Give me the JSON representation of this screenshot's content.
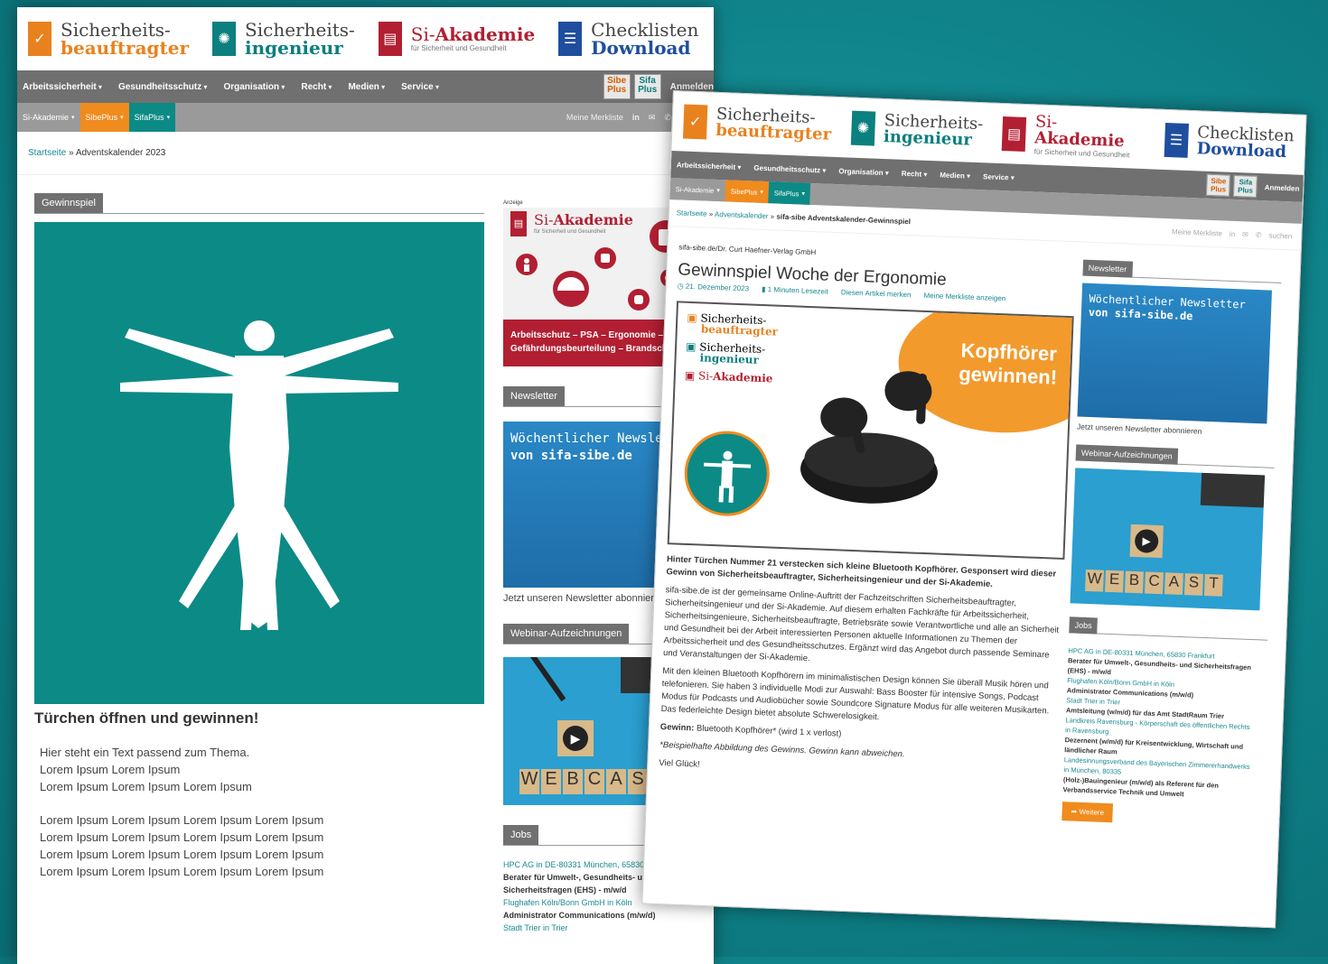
{
  "brands": [
    {
      "line1": "Sicherheits-",
      "line2": "beauftragter",
      "sub": "",
      "color": "#e8821e"
    },
    {
      "line1": "Sicherheits-",
      "line2": "ingenieur",
      "sub": "",
      "color": "#0c7f7f"
    },
    {
      "line1": "Si-",
      "line2": "Akademie",
      "sub": "für Sicherheit und Gesundheit",
      "color": "#b21f32"
    },
    {
      "line1": "Checklisten",
      "line2": "Download",
      "sub": "",
      "color": "#1f4e9e"
    }
  ],
  "nav": {
    "items": [
      "Arbeitssicherheit",
      "Gesundheitsschutz",
      "Organisation",
      "Recht",
      "Medien",
      "Service"
    ],
    "sibe_plus_top": "Sibe",
    "sibe_plus_bottom": "Plus",
    "sifa_plus_top": "Sifa",
    "sifa_plus_bottom": "Plus",
    "login": "Anmelden"
  },
  "subnav": {
    "tabs": [
      "Si-Akademie",
      "SibePlus",
      "SifaPlus"
    ],
    "merkliste": "Meine Merkliste",
    "linkedin": "in",
    "search_placeholder": "suchen"
  },
  "colors": {
    "teal": "#0c8a86",
    "orange": "#f08b1e",
    "red": "#b21f32",
    "gray": "#707070"
  },
  "page1": {
    "breadcrumb_home": "Startseite",
    "breadcrumb_sep": " » ",
    "breadcrumb_current": "Adventskalender 2023",
    "section": "Gewinnspiel",
    "heading": "Türchen öffnen und gewinnen!",
    "para1_lines": [
      "Hier steht ein Text passend zum Thema.",
      "Lorem Ipsum Lorem Ipsum",
      "Lorem Ipsum Lorem Ipsum Lorem Ipsum"
    ],
    "para2_lines": [
      "Lorem Ipsum Lorem Ipsum Lorem Ipsum Lorem Ipsum",
      "Lorem Ipsum Lorem Ipsum Lorem Ipsum Lorem Ipsum",
      "Lorem Ipsum Lorem Ipsum Lorem Ipsum Lorem Ipsum",
      "Lorem Ipsum Lorem Ipsum Lorem Ipsum Lorem Ipsum"
    ]
  },
  "sidebar": {
    "ad_label": "Anzeige",
    "ad_brand_line1": "Si-",
    "ad_brand_line2": "Akademie",
    "ad_brand_sub": "für Sicherheit und Gesundheit",
    "ad_text_line1": "Arbeitsschutz – PSA – Ergonomie –",
    "ad_text_line2": "Gefährdungsbeurteilung – Brandschutz",
    "newsletter_title": "Newsletter",
    "newsletter_line1": "Wöchentlicher Newsletter",
    "newsletter_line2": "von sifa-sibe.de",
    "newsletter_caption": "Jetzt unseren Newsletter abonnieren",
    "webinar_title": "Webinar-Aufzeichnungen",
    "webcast_letters": [
      "W",
      "E",
      "B",
      "C",
      "A",
      "S",
      "T"
    ],
    "jobs_title": "Jobs",
    "jobs": [
      {
        "company": "HPC AG in DE-80331 München, 65830 Frankfurt",
        "title_lines": [
          "Berater für Umwelt-, Gesundheits- und",
          "Sicherheitsfragen (EHS) - m/w/d"
        ]
      },
      {
        "company": "Flughafen Köln/Bonn GmbH in Köln",
        "title_lines": [
          "Administrator Communications (m/w/d)"
        ]
      },
      {
        "company": "Stadt Trier in Trier",
        "title_lines": []
      }
    ]
  },
  "page2": {
    "breadcrumb_home": "Startseite",
    "breadcrumb_mid": "Adventskalender",
    "breadcrumb_current": "sifa-sibe Adventskalender-Gewinnspiel",
    "publisher": "sifa-sibe.de/Dr. Curt Haefner-Verlag GmbH",
    "title": "Gewinnspiel Woche der Ergonomie",
    "date": "21. Dezember 2023",
    "readtime": "1 Minuten Lesezeit",
    "bookmark": "Diesen Artikel merken",
    "show_list": "Meine Merkliste anzeigen",
    "promo_line1": "Kopfhörer",
    "promo_line2": "gewinnen!",
    "lead": "Hinter Türchen Nummer 21 verstecken sich kleine Bluetooth Kopfhörer. Gesponsert wird dieser Gewinn von Sicherheitsbeauftragter, Sicherheitsingenieur und der Si-Akademie.",
    "body1": "sifa-sibe.de ist der gemeinsame Online-Auftritt der Fachzeitschriften Sicherheitsbeauftragter, Sicherheitsingenieur und der Si-Akademie. Auf diesem erhalten Fachkräfte für Arbeitssicherheit, Sicherheitsingenieure, Sicherheitsbeauftragte, Betriebsräte sowie Verantwortliche und alle an Sicherheit und Gesundheit bei der Arbeit interessierten Personen aktuelle Informationen zu Themen der Arbeitssicherheit und des Gesundheitsschutzes. Ergänzt wird das Angebot durch passende Seminare und Veranstaltungen der Si-Akademie.",
    "body2": "Mit den kleinen Bluetooth Kopfhörern im minimalistischen Design können Sie überall Musik hören und telefonieren. Sie haben 3 individuelle Modi zur Auswahl: Bass Booster für intensive Songs, Podcast Modus für Podcasts und Audiobücher sowie Soundcore Signature Modus für alle weiteren Musikarten. Das federleichte Design bietet absolute Schwerelosigkeit.",
    "prize_label": "Gewinn:",
    "prize": " Bluetooth Kopfhörer* (wird 1 x verlost)",
    "disclaimer": "*Beispielhafte Abbildung des Gewinns. Gewinn kann abweichen.",
    "closing": "Viel Glück!",
    "more_button": "Weitere",
    "jobs": [
      {
        "company": "HPC AG in DE-80331 München, 65830 Frankfurt",
        "title": "Berater für Umwelt-, Gesundheits- und Sicherheitsfragen (EHS) - m/w/d"
      },
      {
        "company": "Flughafen Köln/Bonn GmbH in Köln",
        "title": "Administrator Communications (m/w/d)"
      },
      {
        "company": "Stadt Trier in Trier",
        "title": "Amtsleitung (w/m/d) für das Amt StadtRaum Trier"
      },
      {
        "company": "Landkreis Ravensburg - Körperschaft des öffentlichen Rechts in Ravensburg",
        "title": "Dezernent (w/m/d) für Kreisentwicklung, Wirtschaft und ländlicher Raum"
      },
      {
        "company": "Landesinnungsverband des Bayerischen Zimmererhandwerks in München, 80335",
        "title": "(Holz-)Bauingenieur (m/w/d) als Referent für den Verbandsservice Technik und Umwelt"
      }
    ]
  }
}
